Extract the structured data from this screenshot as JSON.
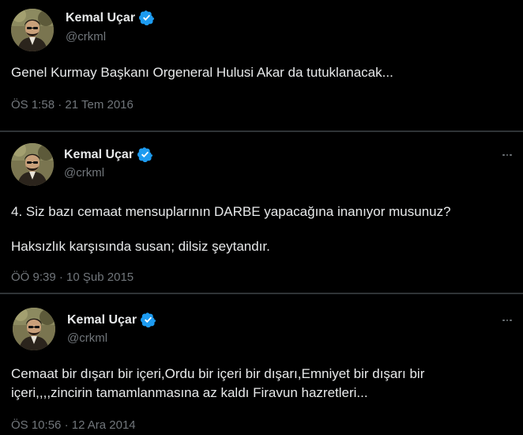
{
  "accent_color": "#1d9bf0",
  "tweets": [
    {
      "author": {
        "name": "Kemal Uçar",
        "handle": "@crkml",
        "verified": true,
        "verified_icon": "verified-badge-icon"
      },
      "text": [
        "Genel Kurmay Başkanı Orgeneral Hulusi Akar da tutuklanacak..."
      ],
      "time": "ÖS 1:58",
      "separator": "·",
      "date": "21 Tem 2016"
    },
    {
      "author": {
        "name": "Kemal Uçar",
        "handle": "@crkml",
        "verified": true,
        "verified_icon": "verified-badge-icon"
      },
      "more_icon": "more-options-icon",
      "text": [
        "4. Siz bazı cemaat mensuplarının DARBE yapacağına inanıyor musunuz?",
        "Haksızlık karşısında susan; dilsiz şeytandır."
      ],
      "time": "ÖÖ 9:39",
      "separator": "·",
      "date": "10 Şub 2015"
    },
    {
      "author": {
        "name": "Kemal Uçar",
        "handle": "@crkml",
        "verified": true,
        "verified_icon": "verified-badge-icon"
      },
      "more_icon": "more-options-icon",
      "text": [
        "Cemaat bir dışarı bir içeri,Ordu bir içeri bir dışarı,Emniyet bir dışarı bir içeri,,,,zincirin tamamlanmasına az kaldı Firavun hazretleri..."
      ],
      "time": "ÖS 10:56",
      "separator": "·",
      "date": "12 Ara 2014"
    }
  ]
}
